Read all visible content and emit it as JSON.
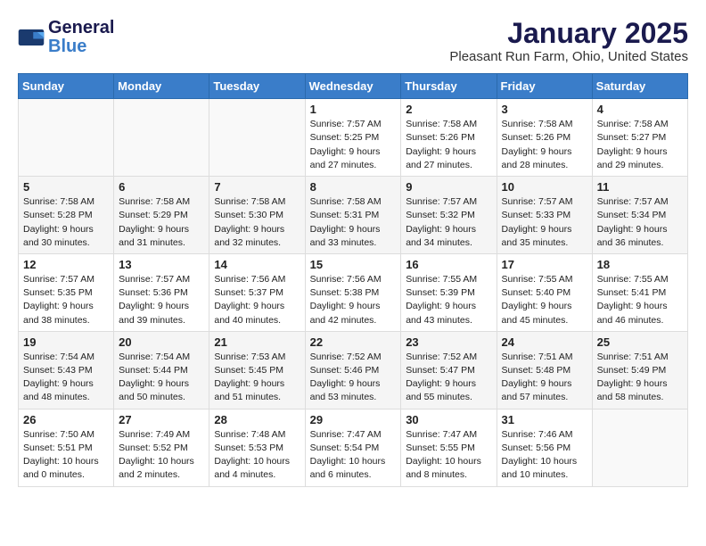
{
  "header": {
    "logo_line1": "General",
    "logo_line2": "Blue",
    "month": "January 2025",
    "location": "Pleasant Run Farm, Ohio, United States"
  },
  "days_of_week": [
    "Sunday",
    "Monday",
    "Tuesday",
    "Wednesday",
    "Thursday",
    "Friday",
    "Saturday"
  ],
  "weeks": [
    [
      {
        "day": "",
        "info": ""
      },
      {
        "day": "",
        "info": ""
      },
      {
        "day": "",
        "info": ""
      },
      {
        "day": "1",
        "info": "Sunrise: 7:57 AM\nSunset: 5:25 PM\nDaylight: 9 hours and 27 minutes."
      },
      {
        "day": "2",
        "info": "Sunrise: 7:58 AM\nSunset: 5:26 PM\nDaylight: 9 hours and 27 minutes."
      },
      {
        "day": "3",
        "info": "Sunrise: 7:58 AM\nSunset: 5:26 PM\nDaylight: 9 hours and 28 minutes."
      },
      {
        "day": "4",
        "info": "Sunrise: 7:58 AM\nSunset: 5:27 PM\nDaylight: 9 hours and 29 minutes."
      }
    ],
    [
      {
        "day": "5",
        "info": "Sunrise: 7:58 AM\nSunset: 5:28 PM\nDaylight: 9 hours and 30 minutes."
      },
      {
        "day": "6",
        "info": "Sunrise: 7:58 AM\nSunset: 5:29 PM\nDaylight: 9 hours and 31 minutes."
      },
      {
        "day": "7",
        "info": "Sunrise: 7:58 AM\nSunset: 5:30 PM\nDaylight: 9 hours and 32 minutes."
      },
      {
        "day": "8",
        "info": "Sunrise: 7:58 AM\nSunset: 5:31 PM\nDaylight: 9 hours and 33 minutes."
      },
      {
        "day": "9",
        "info": "Sunrise: 7:57 AM\nSunset: 5:32 PM\nDaylight: 9 hours and 34 minutes."
      },
      {
        "day": "10",
        "info": "Sunrise: 7:57 AM\nSunset: 5:33 PM\nDaylight: 9 hours and 35 minutes."
      },
      {
        "day": "11",
        "info": "Sunrise: 7:57 AM\nSunset: 5:34 PM\nDaylight: 9 hours and 36 minutes."
      }
    ],
    [
      {
        "day": "12",
        "info": "Sunrise: 7:57 AM\nSunset: 5:35 PM\nDaylight: 9 hours and 38 minutes."
      },
      {
        "day": "13",
        "info": "Sunrise: 7:57 AM\nSunset: 5:36 PM\nDaylight: 9 hours and 39 minutes."
      },
      {
        "day": "14",
        "info": "Sunrise: 7:56 AM\nSunset: 5:37 PM\nDaylight: 9 hours and 40 minutes."
      },
      {
        "day": "15",
        "info": "Sunrise: 7:56 AM\nSunset: 5:38 PM\nDaylight: 9 hours and 42 minutes."
      },
      {
        "day": "16",
        "info": "Sunrise: 7:55 AM\nSunset: 5:39 PM\nDaylight: 9 hours and 43 minutes."
      },
      {
        "day": "17",
        "info": "Sunrise: 7:55 AM\nSunset: 5:40 PM\nDaylight: 9 hours and 45 minutes."
      },
      {
        "day": "18",
        "info": "Sunrise: 7:55 AM\nSunset: 5:41 PM\nDaylight: 9 hours and 46 minutes."
      }
    ],
    [
      {
        "day": "19",
        "info": "Sunrise: 7:54 AM\nSunset: 5:43 PM\nDaylight: 9 hours and 48 minutes."
      },
      {
        "day": "20",
        "info": "Sunrise: 7:54 AM\nSunset: 5:44 PM\nDaylight: 9 hours and 50 minutes."
      },
      {
        "day": "21",
        "info": "Sunrise: 7:53 AM\nSunset: 5:45 PM\nDaylight: 9 hours and 51 minutes."
      },
      {
        "day": "22",
        "info": "Sunrise: 7:52 AM\nSunset: 5:46 PM\nDaylight: 9 hours and 53 minutes."
      },
      {
        "day": "23",
        "info": "Sunrise: 7:52 AM\nSunset: 5:47 PM\nDaylight: 9 hours and 55 minutes."
      },
      {
        "day": "24",
        "info": "Sunrise: 7:51 AM\nSunset: 5:48 PM\nDaylight: 9 hours and 57 minutes."
      },
      {
        "day": "25",
        "info": "Sunrise: 7:51 AM\nSunset: 5:49 PM\nDaylight: 9 hours and 58 minutes."
      }
    ],
    [
      {
        "day": "26",
        "info": "Sunrise: 7:50 AM\nSunset: 5:51 PM\nDaylight: 10 hours and 0 minutes."
      },
      {
        "day": "27",
        "info": "Sunrise: 7:49 AM\nSunset: 5:52 PM\nDaylight: 10 hours and 2 minutes."
      },
      {
        "day": "28",
        "info": "Sunrise: 7:48 AM\nSunset: 5:53 PM\nDaylight: 10 hours and 4 minutes."
      },
      {
        "day": "29",
        "info": "Sunrise: 7:47 AM\nSunset: 5:54 PM\nDaylight: 10 hours and 6 minutes."
      },
      {
        "day": "30",
        "info": "Sunrise: 7:47 AM\nSunset: 5:55 PM\nDaylight: 10 hours and 8 minutes."
      },
      {
        "day": "31",
        "info": "Sunrise: 7:46 AM\nSunset: 5:56 PM\nDaylight: 10 hours and 10 minutes."
      },
      {
        "day": "",
        "info": ""
      }
    ]
  ]
}
